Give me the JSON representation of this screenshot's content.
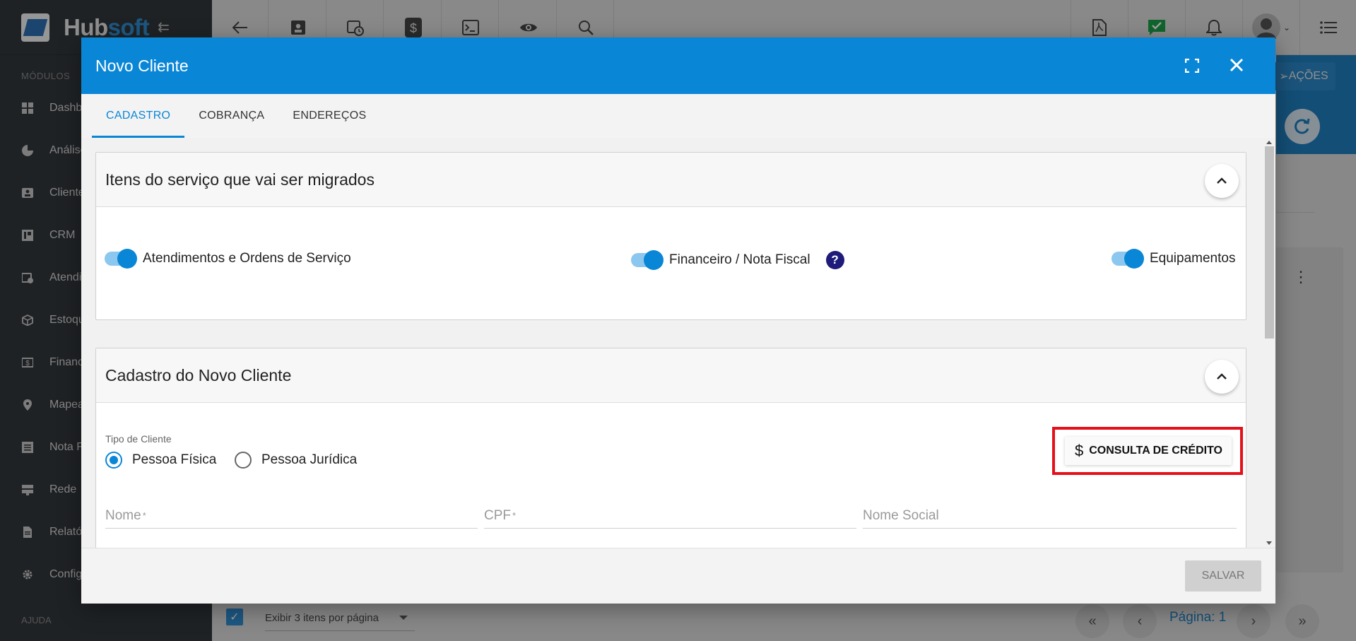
{
  "brand": {
    "part1": "Hub",
    "part2": "soft"
  },
  "sidebar": {
    "section_label": "MÓDULOS",
    "items": [
      {
        "label": "Dashb",
        "icon": "dashboard-icon"
      },
      {
        "label": "Análise",
        "icon": "pie-chart-icon"
      },
      {
        "label": "Clientes",
        "icon": "contact-card-icon"
      },
      {
        "label": "CRM",
        "icon": "kanban-icon"
      },
      {
        "label": "Atendim",
        "icon": "calendar-clock-icon"
      },
      {
        "label": "Estoque",
        "icon": "box-icon"
      },
      {
        "label": "Financ",
        "icon": "money-icon"
      },
      {
        "label": "Mapea",
        "icon": "map-pin-icon"
      },
      {
        "label": "Nota F",
        "icon": "list-icon"
      },
      {
        "label": "Rede",
        "icon": "server-icon"
      },
      {
        "label": "Relató",
        "icon": "document-icon"
      },
      {
        "label": "Config",
        "icon": "gear-icon"
      }
    ],
    "help_label": "AJUDA"
  },
  "background": {
    "actions_label": "AÇÕES",
    "per_page_label": "Exibir 3 itens por página",
    "page_label": "Página: 1"
  },
  "modal": {
    "title": "Novo Cliente",
    "tabs": [
      "CADASTRO",
      "COBRANÇA",
      "ENDEREÇOS"
    ],
    "migration_panel": {
      "title": "Itens do serviço que vai ser migrados",
      "toggles": [
        {
          "label": "Atendimentos e Ordens de Serviço",
          "on": true
        },
        {
          "label": "Financeiro / Nota Fiscal",
          "on": true
        },
        {
          "label": "Equipamentos",
          "on": true
        }
      ]
    },
    "client_panel": {
      "title": "Cadastro do Novo Cliente",
      "client_type_label": "Tipo de Cliente",
      "client_types": [
        {
          "label": "Pessoa Física",
          "selected": true
        },
        {
          "label": "Pessoa Jurídica",
          "selected": false
        }
      ],
      "credit_button": "CONSULTA DE CRÉDITO",
      "fields": [
        {
          "label": "Nome",
          "required": "*"
        },
        {
          "label": "CPF",
          "required": "*"
        },
        {
          "label": "Nome Social",
          "required": ""
        }
      ]
    },
    "save_label": "SALVAR"
  },
  "colors": {
    "primary": "#0a86d6",
    "highlight": "#e4101a",
    "sidebar": "#33373c"
  }
}
